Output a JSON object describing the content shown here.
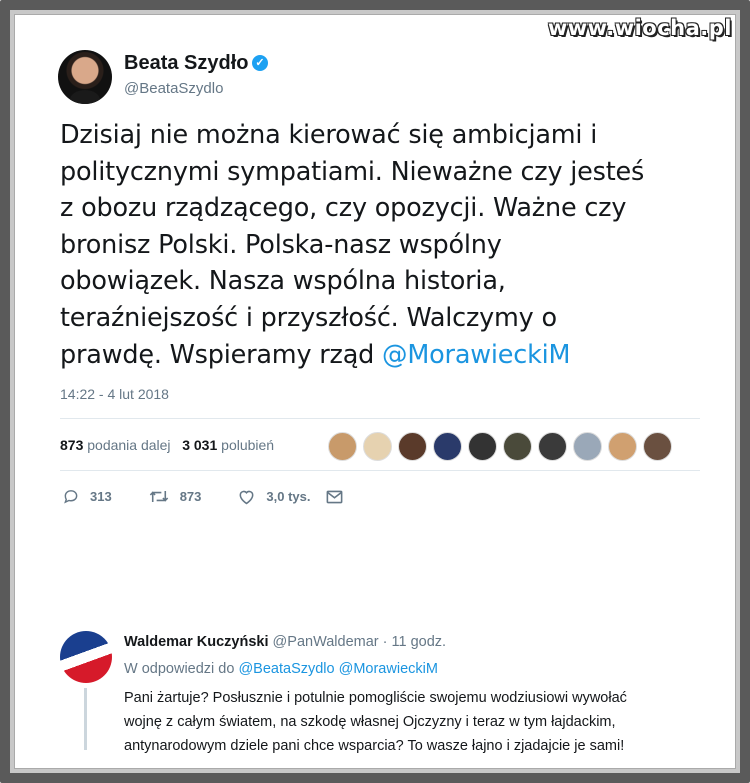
{
  "watermark": "www.wiocha.pl",
  "tweet": {
    "author_name": "Beata Szydło",
    "handle": "@BeataSzydlo",
    "verified_mark": "✓",
    "text_main": "Dzisiaj nie można kierować się ambicjami i\npolitycznymi sympatiami. Nieważne czy jesteś\nz obozu rządzącego, czy opozycji. Ważne czy\nbronisz Polski. Polska-nasz wspólny\nobowiązek. Nasza wspólna historia,\nteraźniejszość i przyszłość. Walczymy o\nprawdę. Wspieramy rząd ",
    "text_mention": "@MorawieckiM",
    "timestamp": "14:22 - 4 lut 2018",
    "retweets_count": "873",
    "retweets_label": "podania dalej",
    "likes_count": "3 031",
    "likes_label": "polubień",
    "likers": [
      "liker-1",
      "liker-2",
      "liker-3",
      "liker-4",
      "liker-5",
      "liker-6",
      "liker-7",
      "liker-8",
      "liker-9",
      "liker-10"
    ],
    "liker_colors": [
      "#c89a6a",
      "#e6d2b0",
      "#5a3a2a",
      "#2a3a6a",
      "#333333",
      "#4a4a3a",
      "#3a3a3a",
      "#9aa8b8",
      "#d0a070",
      "#6a5040"
    ],
    "actions": {
      "reply_count": "313",
      "retweet_count": "873",
      "like_count": "3,0 tys."
    }
  },
  "reply": {
    "author_name": "Waldemar Kuczyński",
    "meta": "@PanWaldemar · 11 godz.",
    "reply_to_label": "W odpowiedzi do",
    "reply_to_mentions": "@BeataSzydlo @MorawieckiM",
    "text": "Pani żartuje? Posłusznie i potulnie pomogliście swojemu wodziusiowi  wywołać\nwojnę z całym światem, na szkodę własnej Ojczyzny i teraz w tym  łajdackim,\nantynarodowym dziele pani chce wsparcia? To wasze łajno i  zjadajcie je sami!"
  },
  "colors": {
    "link": "#1b95e0",
    "secondary": "#657786",
    "verified": "#1da1f2"
  }
}
